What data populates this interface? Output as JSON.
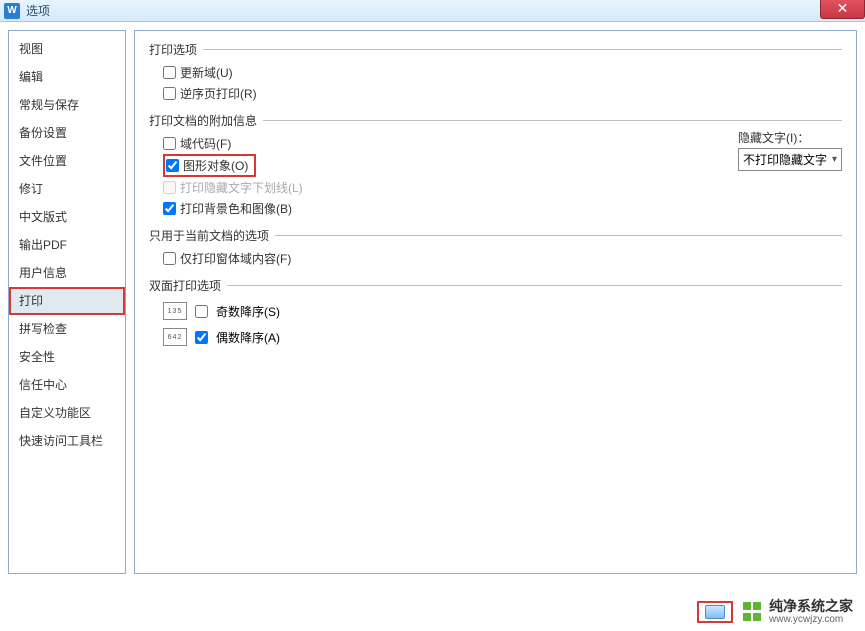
{
  "titlebar": {
    "title": "选项",
    "close": "✕"
  },
  "sidebar": {
    "items": [
      {
        "label": "视图"
      },
      {
        "label": "编辑"
      },
      {
        "label": "常规与保存"
      },
      {
        "label": "备份设置"
      },
      {
        "label": "文件位置"
      },
      {
        "label": "修订"
      },
      {
        "label": "中文版式"
      },
      {
        "label": "输出PDF"
      },
      {
        "label": "用户信息"
      },
      {
        "label": "打印",
        "selected": true
      },
      {
        "label": "拼写检查"
      },
      {
        "label": "安全性"
      },
      {
        "label": "信任中心"
      },
      {
        "label": "自定义功能区"
      },
      {
        "label": "快速访问工具栏"
      }
    ]
  },
  "content": {
    "printOptions": {
      "legend": "打印选项",
      "updateFields": "更新域(U)",
      "reverseOrder": "逆序页打印(R)"
    },
    "attachedInfo": {
      "legend": "打印文档的附加信息",
      "fieldCodes": "域代码(F)",
      "graphicObjects": "图形对象(O)",
      "hiddenUnderline": "打印隐藏文字下划线(L)",
      "backgroundColors": "打印背景色和图像(B)",
      "hiddenTextLabel": "隐藏文字(I)：",
      "hiddenTextSelect": "不打印隐藏文字"
    },
    "currentDoc": {
      "legend": "只用于当前文档的选项",
      "formFieldsOnly": "仅打印窗体域内容(F)"
    },
    "duplex": {
      "legend": "双面打印选项",
      "icon1": "135",
      "oddDesc": "奇数降序(S)",
      "icon2": "642",
      "evenDesc": "偶数降序(A)"
    }
  },
  "watermark": {
    "title": "纯净系统之家",
    "url": "www.ycwjzy.com"
  }
}
